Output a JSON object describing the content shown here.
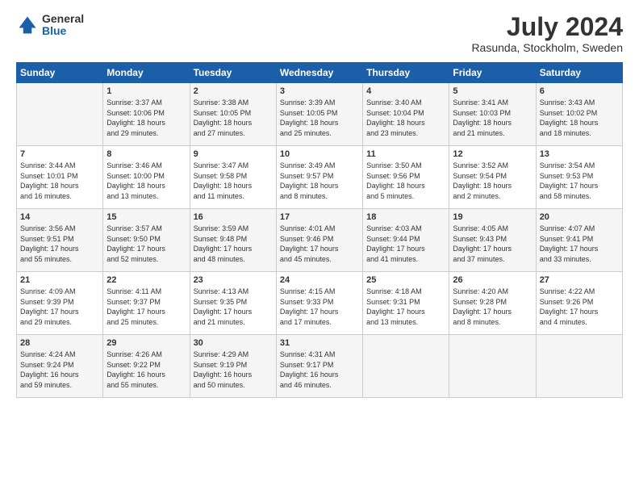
{
  "header": {
    "logo_general": "General",
    "logo_blue": "Blue",
    "month_title": "July 2024",
    "subtitle": "Rasunda, Stockholm, Sweden"
  },
  "days_of_week": [
    "Sunday",
    "Monday",
    "Tuesday",
    "Wednesday",
    "Thursday",
    "Friday",
    "Saturday"
  ],
  "weeks": [
    [
      {
        "day": "",
        "info": ""
      },
      {
        "day": "1",
        "info": "Sunrise: 3:37 AM\nSunset: 10:06 PM\nDaylight: 18 hours\nand 29 minutes."
      },
      {
        "day": "2",
        "info": "Sunrise: 3:38 AM\nSunset: 10:05 PM\nDaylight: 18 hours\nand 27 minutes."
      },
      {
        "day": "3",
        "info": "Sunrise: 3:39 AM\nSunset: 10:05 PM\nDaylight: 18 hours\nand 25 minutes."
      },
      {
        "day": "4",
        "info": "Sunrise: 3:40 AM\nSunset: 10:04 PM\nDaylight: 18 hours\nand 23 minutes."
      },
      {
        "day": "5",
        "info": "Sunrise: 3:41 AM\nSunset: 10:03 PM\nDaylight: 18 hours\nand 21 minutes."
      },
      {
        "day": "6",
        "info": "Sunrise: 3:43 AM\nSunset: 10:02 PM\nDaylight: 18 hours\nand 18 minutes."
      }
    ],
    [
      {
        "day": "7",
        "info": "Sunrise: 3:44 AM\nSunset: 10:01 PM\nDaylight: 18 hours\nand 16 minutes."
      },
      {
        "day": "8",
        "info": "Sunrise: 3:46 AM\nSunset: 10:00 PM\nDaylight: 18 hours\nand 13 minutes."
      },
      {
        "day": "9",
        "info": "Sunrise: 3:47 AM\nSunset: 9:58 PM\nDaylight: 18 hours\nand 11 minutes."
      },
      {
        "day": "10",
        "info": "Sunrise: 3:49 AM\nSunset: 9:57 PM\nDaylight: 18 hours\nand 8 minutes."
      },
      {
        "day": "11",
        "info": "Sunrise: 3:50 AM\nSunset: 9:56 PM\nDaylight: 18 hours\nand 5 minutes."
      },
      {
        "day": "12",
        "info": "Sunrise: 3:52 AM\nSunset: 9:54 PM\nDaylight: 18 hours\nand 2 minutes."
      },
      {
        "day": "13",
        "info": "Sunrise: 3:54 AM\nSunset: 9:53 PM\nDaylight: 17 hours\nand 58 minutes."
      }
    ],
    [
      {
        "day": "14",
        "info": "Sunrise: 3:56 AM\nSunset: 9:51 PM\nDaylight: 17 hours\nand 55 minutes."
      },
      {
        "day": "15",
        "info": "Sunrise: 3:57 AM\nSunset: 9:50 PM\nDaylight: 17 hours\nand 52 minutes."
      },
      {
        "day": "16",
        "info": "Sunrise: 3:59 AM\nSunset: 9:48 PM\nDaylight: 17 hours\nand 48 minutes."
      },
      {
        "day": "17",
        "info": "Sunrise: 4:01 AM\nSunset: 9:46 PM\nDaylight: 17 hours\nand 45 minutes."
      },
      {
        "day": "18",
        "info": "Sunrise: 4:03 AM\nSunset: 9:44 PM\nDaylight: 17 hours\nand 41 minutes."
      },
      {
        "day": "19",
        "info": "Sunrise: 4:05 AM\nSunset: 9:43 PM\nDaylight: 17 hours\nand 37 minutes."
      },
      {
        "day": "20",
        "info": "Sunrise: 4:07 AM\nSunset: 9:41 PM\nDaylight: 17 hours\nand 33 minutes."
      }
    ],
    [
      {
        "day": "21",
        "info": "Sunrise: 4:09 AM\nSunset: 9:39 PM\nDaylight: 17 hours\nand 29 minutes."
      },
      {
        "day": "22",
        "info": "Sunrise: 4:11 AM\nSunset: 9:37 PM\nDaylight: 17 hours\nand 25 minutes."
      },
      {
        "day": "23",
        "info": "Sunrise: 4:13 AM\nSunset: 9:35 PM\nDaylight: 17 hours\nand 21 minutes."
      },
      {
        "day": "24",
        "info": "Sunrise: 4:15 AM\nSunset: 9:33 PM\nDaylight: 17 hours\nand 17 minutes."
      },
      {
        "day": "25",
        "info": "Sunrise: 4:18 AM\nSunset: 9:31 PM\nDaylight: 17 hours\nand 13 minutes."
      },
      {
        "day": "26",
        "info": "Sunrise: 4:20 AM\nSunset: 9:28 PM\nDaylight: 17 hours\nand 8 minutes."
      },
      {
        "day": "27",
        "info": "Sunrise: 4:22 AM\nSunset: 9:26 PM\nDaylight: 17 hours\nand 4 minutes."
      }
    ],
    [
      {
        "day": "28",
        "info": "Sunrise: 4:24 AM\nSunset: 9:24 PM\nDaylight: 16 hours\nand 59 minutes."
      },
      {
        "day": "29",
        "info": "Sunrise: 4:26 AM\nSunset: 9:22 PM\nDaylight: 16 hours\nand 55 minutes."
      },
      {
        "day": "30",
        "info": "Sunrise: 4:29 AM\nSunset: 9:19 PM\nDaylight: 16 hours\nand 50 minutes."
      },
      {
        "day": "31",
        "info": "Sunrise: 4:31 AM\nSunset: 9:17 PM\nDaylight: 16 hours\nand 46 minutes."
      },
      {
        "day": "",
        "info": ""
      },
      {
        "day": "",
        "info": ""
      },
      {
        "day": "",
        "info": ""
      }
    ]
  ]
}
